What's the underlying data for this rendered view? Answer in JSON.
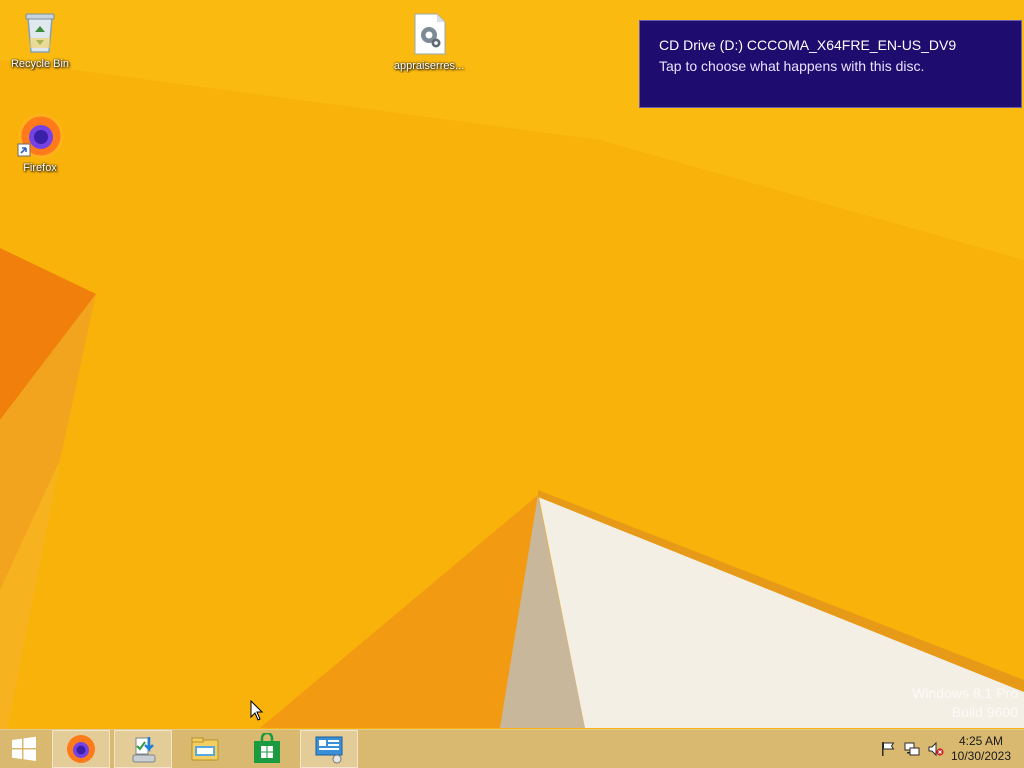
{
  "desktop": {
    "icons": [
      {
        "label": "Recycle Bin",
        "icon": "recycle-bin-icon"
      },
      {
        "label": "appraiserres...",
        "icon": "config-file-icon"
      },
      {
        "label": "Firefox",
        "icon": "firefox-icon"
      }
    ]
  },
  "notification": {
    "title": "CD Drive (D:) CCCOMA_X64FRE_EN-US_DV9",
    "message": "Tap to choose what happens with this disc.",
    "background": "#1e0c6e"
  },
  "watermark": {
    "line1": "Windows 8.1 Pro",
    "line2": "Build 9600"
  },
  "taskbar": {
    "start": "windows-start-icon",
    "pinned": [
      "firefox-icon",
      "installer-download-icon",
      "file-explorer-icon",
      "store-icon",
      "remote-desktop-icon"
    ],
    "tray": [
      "action-center-flag-icon",
      "network-icon",
      "volume-muted-icon"
    ],
    "clock": {
      "time": "4:25 AM",
      "date": "10/30/2023"
    }
  },
  "colors": {
    "wallpaper": "#f9b20a",
    "taskbar": "#d6ba78"
  }
}
